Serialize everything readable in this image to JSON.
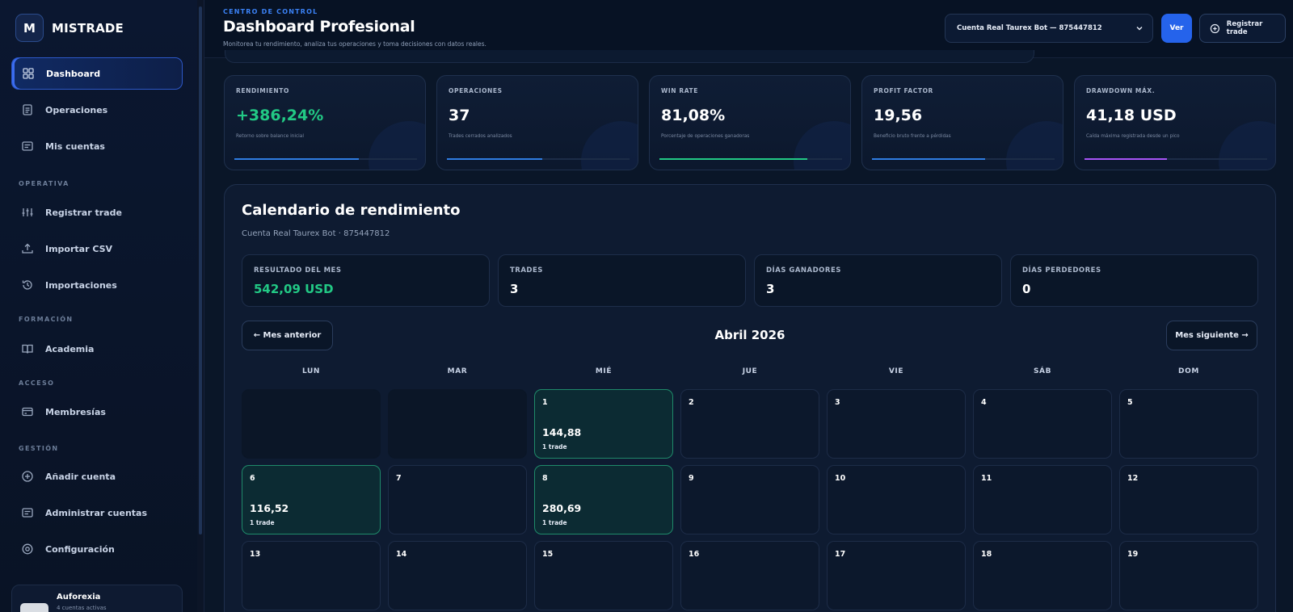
{
  "brand": {
    "logo_letter": "M",
    "name": "MISTRADE"
  },
  "sidebar": {
    "items": [
      {
        "label": "Dashboard"
      },
      {
        "label": "Operaciones"
      },
      {
        "label": "Mis cuentas"
      },
      {
        "label": "Registrar trade"
      },
      {
        "label": "Importar CSV"
      },
      {
        "label": "Importaciones"
      },
      {
        "label": "Academia"
      },
      {
        "label": "Membresías"
      },
      {
        "label": "Añadir cuenta"
      },
      {
        "label": "Administrar cuentas"
      },
      {
        "label": "Configuración"
      }
    ],
    "sections": [
      "OPERATIVA",
      "FORMACIÓN",
      "ACCESO",
      "GESTIÓN"
    ],
    "user": {
      "name": "Auforexia",
      "sub": "4 cuentas activas"
    }
  },
  "header": {
    "eyebrow": "CENTRO DE CONTROL",
    "title": "Dashboard Profesional",
    "subtitle": "Monitorea tu rendimiento, analiza tus operaciones y toma decisiones con datos reales.",
    "account_select": "Cuenta Real Taurex Bot — 875447812",
    "view_button": "Ver",
    "register_button": "Registrar trade"
  },
  "stats": [
    {
      "label": "RENDIMIENTO",
      "value": "+386,24%",
      "desc": "Retorno sobre balance inicial",
      "progress": 0.68,
      "color": "#2f7de1"
    },
    {
      "label": "OPERACIONES",
      "value": "37",
      "desc": "Trades cerrados analizados",
      "progress": 0.52,
      "color": "#2f7de1"
    },
    {
      "label": "WIN RATE",
      "value": "81,08%",
      "desc": "Porcentaje de operaciones ganadoras",
      "progress": 0.81,
      "color": "#22c985"
    },
    {
      "label": "PROFIT FACTOR",
      "value": "19,56",
      "desc": "Beneficio bruto frente a pérdidas",
      "progress": 0.62,
      "color": "#2f7de1"
    },
    {
      "label": "DRAWDOWN MÁX.",
      "value": "41,18 USD",
      "desc": "Caída máxima registrada desde un pico",
      "progress": 0.45,
      "color": "#a855f7"
    }
  ],
  "calendar": {
    "title": "Calendario de rendimiento",
    "subtitle": "Cuenta Real Taurex Bot · 875447812",
    "summary": [
      {
        "label": "RESULTADO DEL MES",
        "value": "542,09 USD"
      },
      {
        "label": "TRADES",
        "value": "3"
      },
      {
        "label": "DÍAS GANADORES",
        "value": "3"
      },
      {
        "label": "DÍAS PERDEDORES",
        "value": "0"
      }
    ],
    "prev_button": "← Mes anterior",
    "next_button": "Mes siguiente →",
    "month": "Abril 2026",
    "weekdays": [
      "LUN",
      "MAR",
      "MIÉ",
      "JUE",
      "VIE",
      "SÁB",
      "DOM"
    ],
    "days": [
      {
        "num": "1",
        "value": "144,88",
        "trades": "1 trade"
      },
      {
        "num": "2"
      },
      {
        "num": "3"
      },
      {
        "num": "4"
      },
      {
        "num": "5"
      },
      {
        "num": "6",
        "value": "116,52",
        "trades": "1 trade"
      },
      {
        "num": "7"
      },
      {
        "num": "8",
        "value": "280,69",
        "trades": "1 trade"
      },
      {
        "num": "9"
      },
      {
        "num": "10"
      },
      {
        "num": "11"
      },
      {
        "num": "12"
      },
      {
        "num": "13"
      },
      {
        "num": "14"
      },
      {
        "num": "15"
      },
      {
        "num": "16"
      },
      {
        "num": "17"
      },
      {
        "num": "18"
      },
      {
        "num": "19"
      }
    ]
  }
}
